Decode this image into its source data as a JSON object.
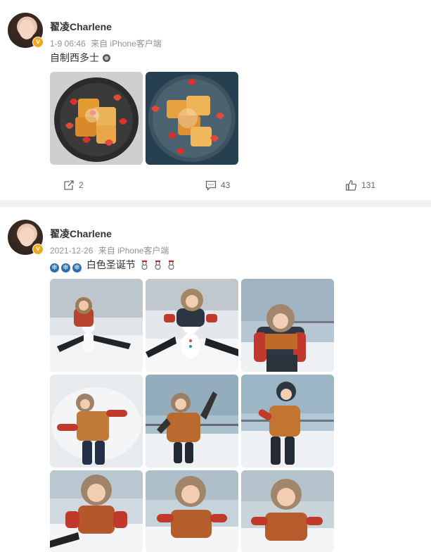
{
  "post1": {
    "username": "翟凌Charlene",
    "time": "1-9 06:46",
    "source": "来自 iPhone客户端",
    "text": "自制西多士",
    "actions": {
      "repost_count": "2",
      "comment_count": "43",
      "like_count": "131"
    }
  },
  "post2": {
    "username": "翟凌Charlene",
    "time": "2021-12-26",
    "source": "来自 iPhone客户端",
    "text": "白色圣诞节"
  },
  "colors": {
    "verified": "#f3a81b",
    "divider": "#f2f2f2",
    "meta": "#939393"
  }
}
